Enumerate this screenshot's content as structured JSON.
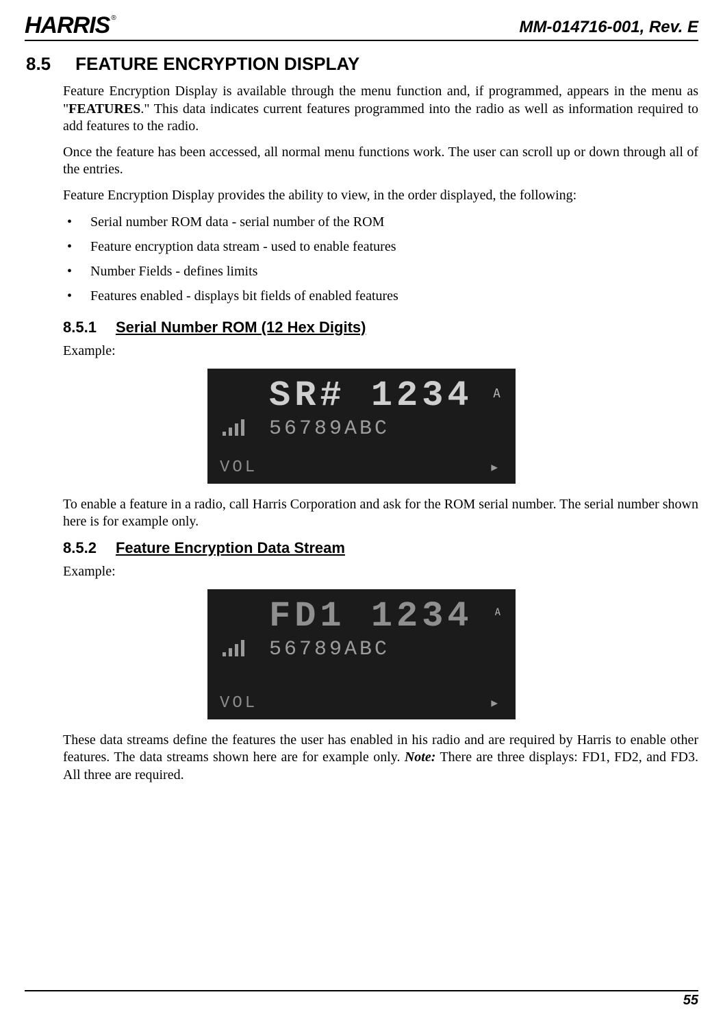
{
  "header": {
    "logo_text": "HARRIS",
    "logo_reg": "®",
    "doc_id": "MM-014716-001, Rev. E"
  },
  "section": {
    "num": "8.5",
    "title": "FEATURE ENCRYPTION DISPLAY"
  },
  "para1_a": "Feature Encryption Display is available through the menu function and, if programmed, appears in the menu as \"",
  "para1_feat": "FEATURES",
  "para1_b": ".\" This data indicates current features programmed into the radio as well as information required to add features to the radio.",
  "para2": "Once the feature has been accessed, all normal menu functions work. The user can scroll up or down through all of the entries.",
  "para3": "Feature Encryption Display provides the ability to view, in the order displayed, the following:",
  "bullets": [
    "Serial number ROM data - serial number of the ROM",
    "Feature encryption data stream - used to enable features",
    "Number Fields - defines limits",
    "Features enabled - displays bit fields of enabled features"
  ],
  "sub1": {
    "num": "8.5.1",
    "title": "Serial Number ROM (12 Hex Digits)"
  },
  "example_label": "Example:",
  "lcd1": {
    "line1": "SR# 1234",
    "line2": "56789ABC",
    "vol": "VOL",
    "a": "A",
    "arrow": "▶"
  },
  "para4": "To enable a feature in a radio, call Harris Corporation and ask for the ROM serial number. The serial number shown here is for example only.",
  "sub2": {
    "num": "8.5.2",
    "title": "Feature Encryption Data Stream"
  },
  "lcd2": {
    "line1": "FD1 1234",
    "line2": "56789ABC",
    "vol": "VOL",
    "a": "A",
    "arrow": "▶"
  },
  "para5_a": "These data streams define the features the user has enabled in his radio and are required by Harris to enable other features. The data streams shown here are for example only. ",
  "para5_note": "Note:",
  "para5_b": " There are three displays: FD1, FD2, and FD3. All three are required.",
  "footer": {
    "page": "55"
  }
}
